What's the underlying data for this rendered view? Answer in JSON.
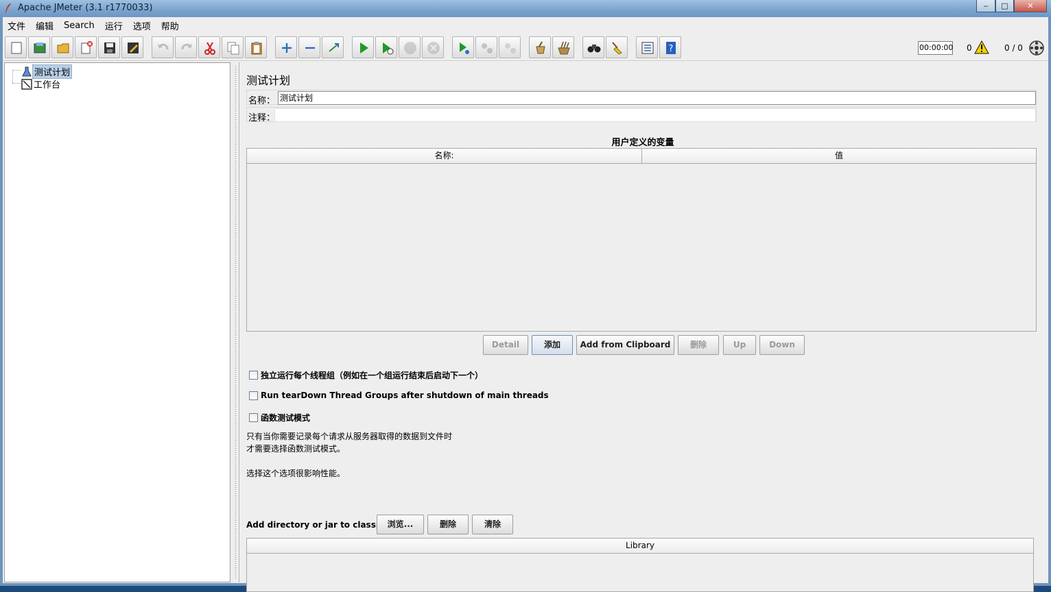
{
  "window": {
    "title": "Apache JMeter (3.1 r1770033)",
    "controls": {
      "minimize": "‒",
      "maximize": "□",
      "close": "✕"
    }
  },
  "menu": [
    "文件",
    "编辑",
    "Search",
    "运行",
    "选项",
    "帮助"
  ],
  "toolbar": {
    "buttons": [
      {
        "name": "new-icon"
      },
      {
        "name": "templates-icon"
      },
      {
        "name": "open-icon"
      },
      {
        "name": "close-icon"
      },
      {
        "name": "save-icon"
      },
      {
        "name": "save-as-icon"
      },
      {
        "name": "undo-icon"
      },
      {
        "name": "redo-icon"
      },
      {
        "name": "cut-icon"
      },
      {
        "name": "copy-icon"
      },
      {
        "name": "paste-icon"
      },
      {
        "name": "expand-icon"
      },
      {
        "name": "collapse-icon"
      },
      {
        "name": "toggle-icon"
      },
      {
        "name": "start-icon"
      },
      {
        "name": "start-no-timers-icon"
      },
      {
        "name": "stop-icon"
      },
      {
        "name": "shutdown-icon"
      },
      {
        "name": "remote-start-icon"
      },
      {
        "name": "remote-stop-icon"
      },
      {
        "name": "remote-shutdown-icon"
      },
      {
        "name": "clear-icon"
      },
      {
        "name": "clear-all-icon"
      },
      {
        "name": "search-icon"
      },
      {
        "name": "reset-search-icon"
      },
      {
        "name": "function-helper-icon"
      },
      {
        "name": "help-icon"
      }
    ],
    "timer": "00:00:00",
    "error_count": "0",
    "threads": "0 / 0"
  },
  "tree": {
    "items": [
      {
        "label": "测试计划",
        "selected": true
      },
      {
        "label": "工作台",
        "selected": false
      }
    ]
  },
  "panel": {
    "title": "测试计划",
    "name_label": "名称：",
    "name_value": "测试计划",
    "comment_label": "注释：",
    "comment_value": "",
    "variables_title": "用户定义的变量",
    "columns": [
      "名称:",
      "值"
    ],
    "buttons": {
      "detail": "Detail",
      "add": "添加",
      "add_clipboard": "Add from Clipboard",
      "delete": "删除",
      "up": "Up",
      "down": "Down"
    },
    "checkboxes": [
      {
        "label": "独立运行每个线程组（例如在一个组运行结束后启动下一个）",
        "checked": false
      },
      {
        "label": "Run tearDown Thread Groups after shutdown of main threads",
        "checked": false
      },
      {
        "label": "函数测试模式",
        "checked": false
      }
    ],
    "notes": [
      "只有当你需要记录每个请求从服务器取得的数据到文件时",
      "才需要选择函数测试模式。",
      "选择这个选项很影响性能。"
    ],
    "classpath": {
      "label": "Add directory or jar to classpath",
      "browse": "浏览...",
      "delete": "删除",
      "clear": "清除",
      "library_header": "Library"
    }
  }
}
